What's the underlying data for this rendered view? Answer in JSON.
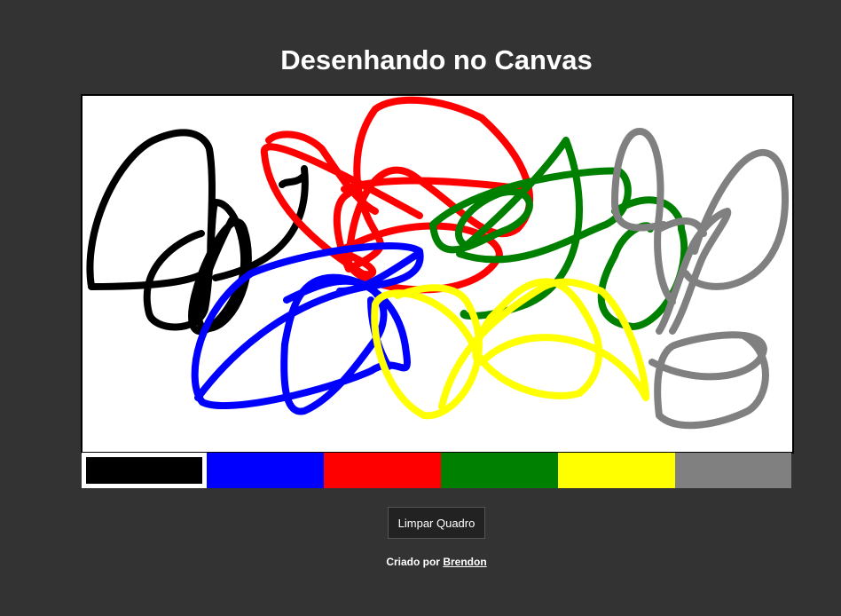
{
  "header": {
    "title": "Desenhando no Canvas"
  },
  "canvas": {
    "background_color": "#ffffff",
    "strokes": [
      {
        "color": "#000000"
      },
      {
        "color": "#ff0000"
      },
      {
        "color": "#0000ff"
      },
      {
        "color": "#008000"
      },
      {
        "color": "#ffff00"
      },
      {
        "color": "#808080"
      }
    ]
  },
  "palette": {
    "colors": [
      "#000000",
      "#0000ff",
      "#ff0000",
      "#008000",
      "#ffff00",
      "#808080"
    ],
    "selected": "#000000"
  },
  "toolbar": {
    "clear_label": "Limpar Quadro"
  },
  "footer": {
    "prefix": "Criado por",
    "author": "Brendon"
  }
}
